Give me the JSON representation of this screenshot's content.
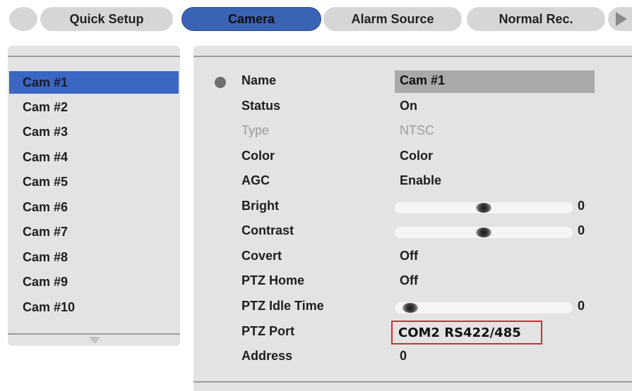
{
  "tabs": [
    {
      "label": "Quick Setup"
    },
    {
      "label": "Camera",
      "active": true
    },
    {
      "label": "Alarm Source"
    },
    {
      "label": "Normal Rec."
    }
  ],
  "camera_list": {
    "items": [
      "Cam #1",
      "Cam #2",
      "Cam #3",
      "Cam #4",
      "Cam #5",
      "Cam #6",
      "Cam #7",
      "Cam #8",
      "Cam #9",
      "Cam #10"
    ],
    "selected": "Cam #1"
  },
  "settings": {
    "name": {
      "label": "Name",
      "value": "Cam #1"
    },
    "status": {
      "label": "Status",
      "value": "On"
    },
    "type": {
      "label": "Type",
      "value": "NTSC",
      "disabled": true
    },
    "color": {
      "label": "Color",
      "value": "Color"
    },
    "agc": {
      "label": "AGC",
      "value": "Enable"
    },
    "bright": {
      "label": "Bright",
      "value": "0",
      "level": 0.5
    },
    "contrast": {
      "label": "Contrast",
      "value": "0",
      "level": 0.5
    },
    "covert": {
      "label": "Covert",
      "value": "Off"
    },
    "ptz_home": {
      "label": "PTZ Home",
      "value": "Off"
    },
    "ptz_idle_time": {
      "label": "PTZ Idle Time",
      "value": "0",
      "level": 0.0
    },
    "ptz_port": {
      "label": "PTZ Port",
      "value": "COM2 RS422/485"
    },
    "address": {
      "label": "Address",
      "value": "0"
    }
  },
  "colors": {
    "active_tab": "#3b63b3",
    "selected_item": "#3b66c4",
    "highlight_border": "#d13030",
    "panel_bg": "#e3e3e3"
  }
}
